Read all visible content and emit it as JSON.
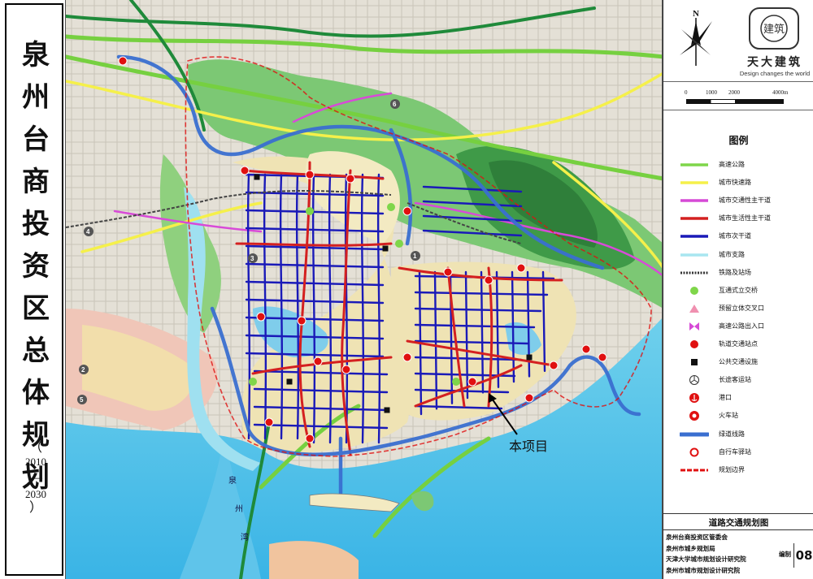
{
  "title": {
    "chars": [
      "泉",
      "州",
      "台",
      "商",
      "投",
      "资",
      "区",
      "总",
      "体",
      "规",
      "划"
    ],
    "year_open": "（",
    "year_start": "2010",
    "year_dash": "—",
    "year_end": "2030",
    "year_close": "）"
  },
  "logo": {
    "seal_text": "建筑",
    "name": "天大建筑",
    "slogan": "Design changes the world"
  },
  "compass": {
    "north_label": "N"
  },
  "scale": {
    "labels": [
      "0",
      "1000",
      "2000",
      "4000m"
    ]
  },
  "legend": {
    "title": "图例",
    "items": [
      {
        "label": "高速公路",
        "symbol": "line",
        "color": "#7fd64a"
      },
      {
        "label": "城市快速路",
        "symbol": "line",
        "color": "#f5f04a"
      },
      {
        "label": "城市交通性主干道",
        "symbol": "line",
        "color": "#d64ad6"
      },
      {
        "label": "城市生活性主干道",
        "symbol": "line",
        "color": "#d42020"
      },
      {
        "label": "城市次干道",
        "symbol": "line",
        "color": "#1a1ab8"
      },
      {
        "label": "城市支路",
        "symbol": "line",
        "color": "#a8e6f0"
      },
      {
        "label": "铁路及站场",
        "symbol": "railway",
        "color": "#333333"
      },
      {
        "label": "互通式立交桥",
        "symbol": "circle",
        "color": "#7fd64a"
      },
      {
        "label": "预留立体交叉口",
        "symbol": "triangle",
        "color": "#f090b0"
      },
      {
        "label": "高速公路出入口",
        "symbol": "bowtie",
        "color": "#d64ad6"
      },
      {
        "label": "轨道交通站点",
        "symbol": "dot",
        "color": "#e01010"
      },
      {
        "label": "公共交通设施",
        "symbol": "square",
        "color": "#111111"
      },
      {
        "label": "长途客运站",
        "symbol": "mercedes",
        "color": "#333333"
      },
      {
        "label": "港口",
        "symbol": "port",
        "color": "#e01010"
      },
      {
        "label": "火车站",
        "symbol": "train",
        "color": "#e01010"
      },
      {
        "label": "绿道线路",
        "symbol": "greenway",
        "color": "#3a6fd0"
      },
      {
        "label": "自行车驿站",
        "symbol": "ring",
        "color": "#e01010"
      },
      {
        "label": "规划边界",
        "symbol": "boundary",
        "color": "#e01010"
      }
    ]
  },
  "map_labels": {
    "project_marker": "本项目",
    "sea_chars": [
      "泉",
      "州",
      "湾"
    ],
    "route_numbers": [
      "1",
      "2",
      "3",
      "4",
      "5",
      "6"
    ]
  },
  "bottom": {
    "drawing_title": "道路交通规划图",
    "orgs": [
      "泉州台商投资区管委会",
      "泉州市城乡规划局",
      "天津大学城市规划设计研究院",
      "泉州市城市规划设计研究院"
    ],
    "number_label": "编制",
    "number_value": "08"
  }
}
